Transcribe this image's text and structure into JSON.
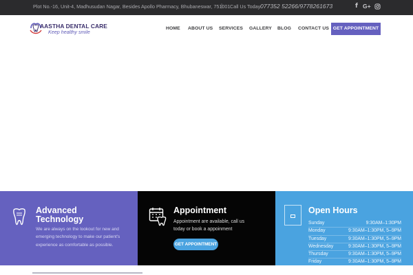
{
  "topbar": {
    "address": "Plot No.-16, Unit-4, Madhusudan Nagar, Besides Apollo Pharmacy, Bhubaneswar, 751001",
    "separator": "|",
    "call_label": "Call Us Today:",
    "phone": "077352 52266/9778261673",
    "social": [
      {
        "icon": "facebook-icon",
        "glyph": "f"
      },
      {
        "icon": "google-plus-icon",
        "glyph": "G+"
      },
      {
        "icon": "instagram-icon",
        "glyph": ""
      }
    ]
  },
  "header": {
    "logo_title": "AASTHA DENTAL CARE",
    "logo_tagline": "Keep healthy smile",
    "nav": [
      {
        "label": "HOME"
      },
      {
        "label": "ABOUT US"
      },
      {
        "label": "SERVICES"
      },
      {
        "label": "GALLERY"
      },
      {
        "label": "BLOG"
      },
      {
        "label": "CONTACT US"
      }
    ],
    "cta_label": "GET APPOINTMENT"
  },
  "colors": {
    "topbar": "#2b2b2d",
    "accent_purple": "#6561bf",
    "accent_blue": "#4aa3e0",
    "panel_black": "#050505"
  },
  "panels": {
    "advanced": {
      "icon": "tooth-icon",
      "title_line1": "Advanced",
      "title_line2": "Technology",
      "text": "We are always on the lookout for new and emerging technology to make our patient's experience as comfortable as possible."
    },
    "appointment": {
      "icon": "calendar-tooth-icon",
      "title": "Appointment",
      "text": "Appointment are available, call us today or book a appoinment",
      "button_label": "GET APPOINTMENT"
    },
    "hours": {
      "icon": "calendar-icon",
      "title": "Open Hours",
      "rows": [
        {
          "day": "Sunday",
          "time": "9:30AM–1:30PM"
        },
        {
          "day": "Monday",
          "time": "9:30AM–1:30PM, 5–9PM"
        },
        {
          "day": "Tuesday",
          "time": "9:30AM–1:30PM, 5–9PM"
        },
        {
          "day": "Wednesday",
          "time": "9:30AM–1:30PM, 5–9PM"
        },
        {
          "day": "Thursday",
          "time": "9:30AM–1:30PM, 5–9PM"
        },
        {
          "day": "Friday",
          "time": "9:30AM–1:30PM, 5–9PM"
        }
      ]
    }
  }
}
